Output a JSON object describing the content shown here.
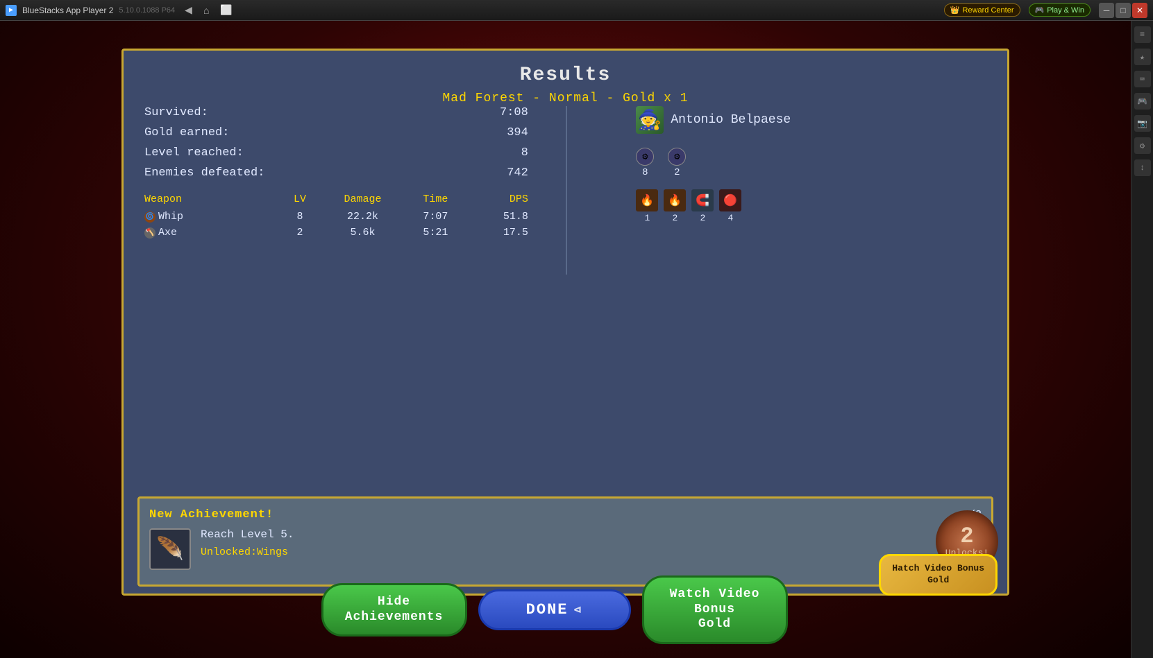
{
  "titlebar": {
    "app_name": "BlueStacks App Player 2",
    "version": "5.10.0.1088  P64",
    "reward_center": "Reward Center",
    "play_win": "Play & Win"
  },
  "results": {
    "title": "Results",
    "stage_info": "Mad Forest - Normal - Gold x 1",
    "stats": {
      "survived_label": "Survived:",
      "survived_value": "7:08",
      "gold_label": "Gold earned:",
      "gold_value": "394",
      "level_label": "Level reached:",
      "level_value": "8",
      "enemies_label": "Enemies defeated:",
      "enemies_value": "742"
    },
    "weapon_table": {
      "headers": {
        "weapon": "Weapon",
        "lv": "LV",
        "damage": "Damage",
        "time": "Time",
        "dps": "DPS"
      },
      "rows": [
        {
          "name": "Whip",
          "lv": "8",
          "damage": "22.2k",
          "time": "7:07",
          "dps": "51.8"
        },
        {
          "name": "Axe",
          "lv": "2",
          "damage": "5.6k",
          "time": "5:21",
          "dps": "17.5"
        }
      ]
    },
    "character": {
      "name": "Antonio Belpaese",
      "stat1_icon": "⚙",
      "stat1_val": "8",
      "stat2_icon": "⚙",
      "stat2_val": "2",
      "items": [
        {
          "icon": "🔥",
          "val": "1"
        },
        {
          "icon": "🔥",
          "val": "2"
        },
        {
          "icon": "🧲",
          "val": "2"
        },
        {
          "icon": "🔴",
          "val": "4"
        }
      ]
    },
    "achievement": {
      "title": "New Achievement!",
      "counter": "1/2",
      "description": "Reach Level 5.",
      "unlocked": "Unlocked:Wings",
      "unlocks_number": "2",
      "unlocks_text": "Unlocks!"
    }
  },
  "buttons": {
    "hide_achievements": "Hide\nAchievements",
    "done": "DONE",
    "watch_video": "Watch Video Bonus\nGold"
  },
  "hatch_badge": {
    "line1": "Hatch Video Bonus",
    "line2": "Gold"
  }
}
